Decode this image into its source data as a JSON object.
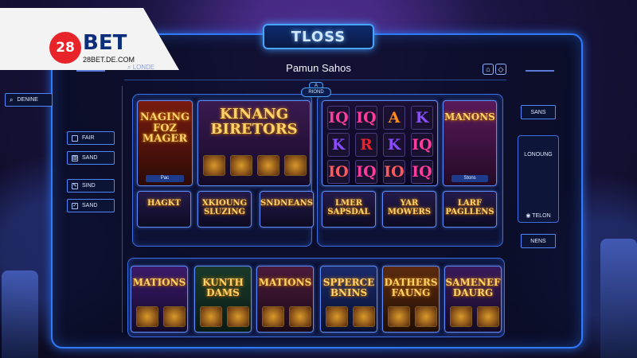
{
  "logo": {
    "mark": "28",
    "word": "BET",
    "sub": "28BET.DE.COM"
  },
  "window": {
    "title": "TLOSS"
  },
  "header": {
    "title": "Pamun Sahos",
    "search_label": "LONDE",
    "icons": [
      "home-icon",
      "chevron-down-icon"
    ]
  },
  "center_tag": {
    "top": "A",
    "label": "RIOND"
  },
  "sidebar": {
    "search_label": "DENINE",
    "items": [
      {
        "icon": "square-icon",
        "label": "FAIR"
      },
      {
        "icon": "chart-icon",
        "label": "SAND"
      },
      {
        "icon": "edit-icon",
        "label": "SIND"
      },
      {
        "icon": "check-icon",
        "label": "SAND"
      }
    ]
  },
  "top_games": [
    {
      "name": "NAGING\nFOZ\nMAGER",
      "footer": "Pac",
      "colors": [
        "#7a1b10",
        "#2b0b06"
      ]
    },
    {
      "name": "KINANG\nBIRETORS",
      "footer": "",
      "colors": [
        "#3a1a50",
        "#140a26"
      ]
    },
    {
      "name": "",
      "footer": "",
      "colors": [
        "#1b0f34",
        "#0a0620"
      ]
    },
    {
      "name": "MANONS",
      "footer": "Stons",
      "colors": [
        "#5a1a5a",
        "#220a26"
      ]
    }
  ],
  "reel_symbols": [
    "IQ",
    "IQ",
    "A",
    "K",
    "K",
    "R",
    "K",
    "IQ",
    "IO",
    "IQ",
    "IO",
    "IQ"
  ],
  "banners": [
    "HAGKT",
    "XKIOUNG\nSLUZING",
    "SNDNEANS",
    "LMER\nSAPSDAL",
    "YAR\nMOWERS",
    "LARF\nPAGLLENS"
  ],
  "bottom_games": [
    {
      "name": "MATIONS",
      "colors": [
        "#3a1a6a",
        "#140a2a"
      ]
    },
    {
      "name": "KUNTH\nDAMS",
      "colors": [
        "#1a3a2a",
        "#0a1a14"
      ]
    },
    {
      "name": "MATIONS",
      "colors": [
        "#4a1a3a",
        "#1a0a18"
      ]
    },
    {
      "name": "SPPERCE\nBNINS",
      "colors": [
        "#1a2a6a",
        "#0a1030"
      ]
    },
    {
      "name": "DATHERS\nFAUNG",
      "colors": [
        "#5a2a10",
        "#220e04"
      ]
    },
    {
      "name": "SAMENEF\nDAURG",
      "colors": [
        "#3a1a5a",
        "#140a24"
      ]
    }
  ],
  "right_panel": {
    "top_button": "SANS",
    "box_label": "LONOUNG",
    "box_footer": "TELON",
    "bottom_button": "NENS"
  },
  "colors": {
    "accent": "#2f7bff",
    "gold_text": "#ffd36a",
    "brand_red": "#e8232a",
    "brand_blue": "#0d2e7a"
  }
}
